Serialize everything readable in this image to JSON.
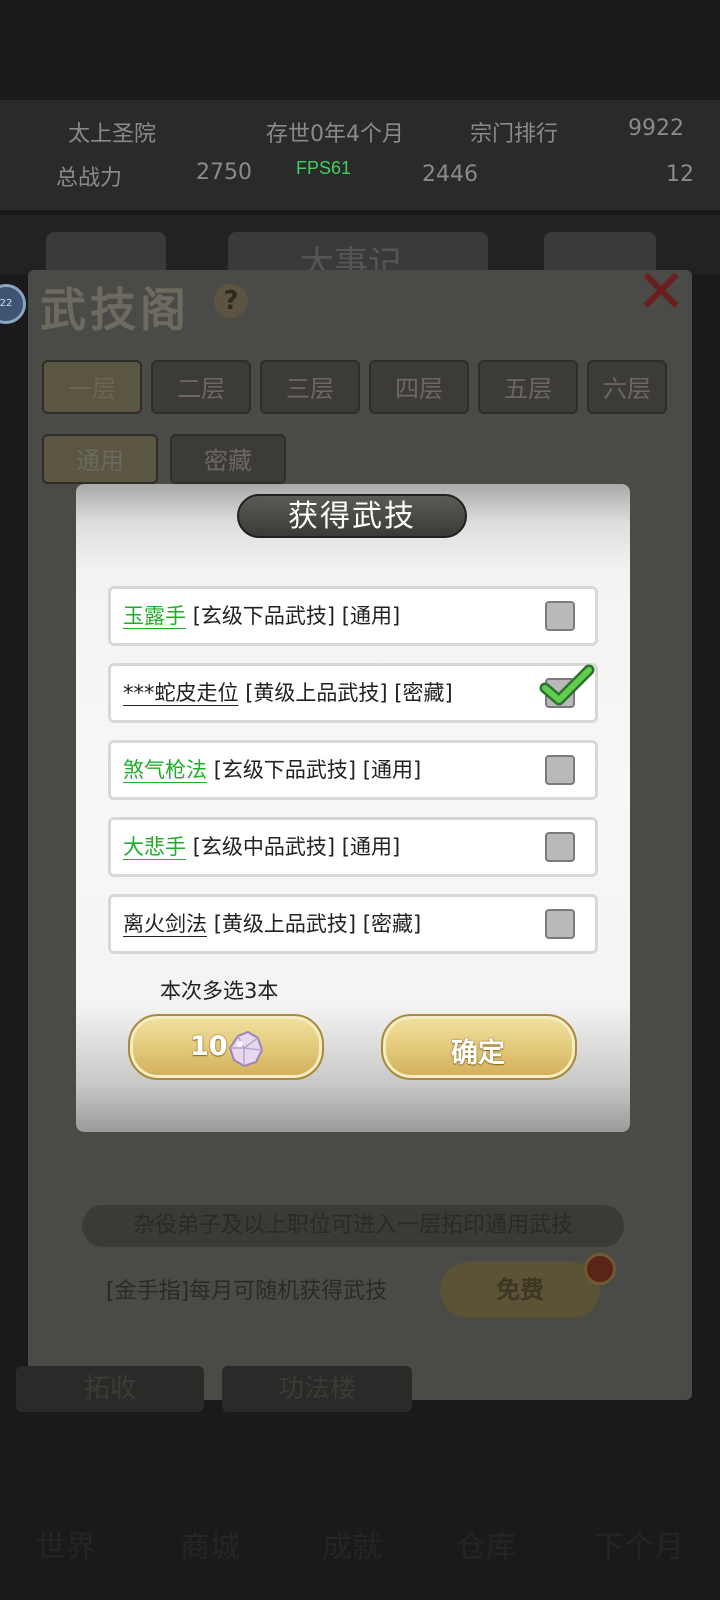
{
  "background": {
    "stats_row1": [
      "太上圣院",
      "存世0年4个月",
      "宗门排行",
      "9922"
    ],
    "stats_row2": [
      "总战力",
      "2750",
      "2446",
      "12"
    ],
    "fps": "FPS61",
    "event_title": "大事记",
    "pavilion_title": "武技阁",
    "help_icon": "?",
    "avatar_badge": "22",
    "floors": [
      "一层",
      "二层",
      "三层",
      "四层",
      "五层",
      "六层"
    ],
    "types": [
      "通用",
      "密藏"
    ],
    "hint": "杂役弟子及以上职位可进入一层拓印通用武技",
    "gold_finger_text": "[金手指]每月可随机获得武技",
    "free_button": "免费",
    "bottom_buttons": [
      "拓收",
      "功法楼"
    ],
    "nav": [
      "世界",
      "商城",
      "成就",
      "仓库",
      "下个月"
    ]
  },
  "modal": {
    "title": "获得武技",
    "items": [
      {
        "name": "玉露手",
        "detail": "[玄级下品武技] [通用]",
        "name_color": "green",
        "checked": false
      },
      {
        "name": "***蛇皮走位",
        "detail": "[黄级上品武技] [密藏]",
        "name_color": "black",
        "checked": true
      },
      {
        "name": "煞气枪法",
        "detail": "[玄级下品武技] [通用]",
        "name_color": "green",
        "checked": false
      },
      {
        "name": "大悲手",
        "detail": "[玄级中品武技] [通用]",
        "name_color": "green",
        "checked": false
      },
      {
        "name": "离火剑法",
        "detail": "[黄级上品武技] [密藏]",
        "name_color": "black",
        "checked": false
      }
    ],
    "multi_select_label": "本次多选3本",
    "cost_value": "10",
    "cost_icon": "spirit-stone-icon",
    "confirm_label": "确定"
  },
  "colors": {
    "green_name": "#1fae2a",
    "gold_button": "#e2c878",
    "title_bar": "#3a3a37"
  }
}
